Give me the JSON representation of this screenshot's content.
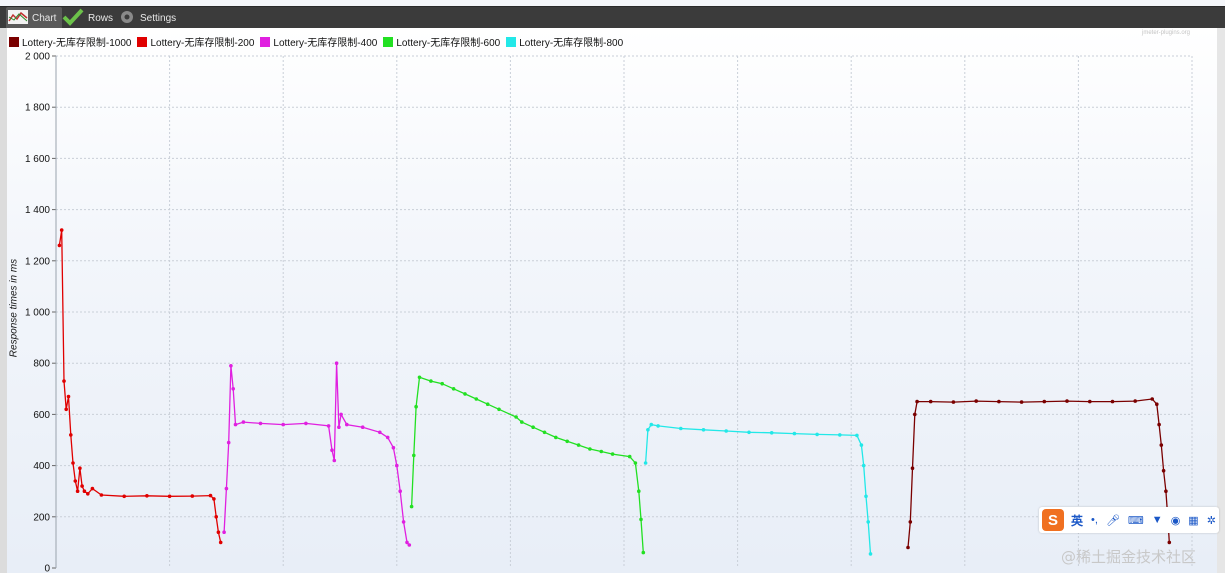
{
  "toolbar": {
    "tabs": [
      {
        "label": "Chart",
        "icon": "chart-icon"
      },
      {
        "label": "Rows",
        "icon": "checkmark-icon"
      },
      {
        "label": "Settings",
        "icon": "gear-icon"
      }
    ]
  },
  "watermark_top": "jmeter-plugins.org",
  "footer_watermark": "@稀土掘金技术社区",
  "ime_toolbar": {
    "logo": "S",
    "label": "英",
    "icons": [
      "punctuation-icon",
      "microphone-icon",
      "keyboard-icon",
      "shirt-icon",
      "gamepad-icon",
      "grid-icon",
      "gear-icon"
    ]
  },
  "chart_data": {
    "type": "line",
    "ylabel": "Response times in ms",
    "ylim": [
      0,
      2000
    ],
    "yticks": [
      0,
      200,
      400,
      600,
      800,
      1000,
      1200,
      1400,
      1600,
      1800,
      2000
    ],
    "ytick_labels": [
      "0",
      "200",
      "400",
      "600",
      "800",
      "1 000",
      "1 200",
      "1 400",
      "1 600",
      "1 800",
      "2 000"
    ],
    "x_range": [
      0,
      100
    ],
    "grid": true,
    "legend_position": "top-left",
    "series": [
      {
        "name": "Lottery-无库存限制-1000",
        "color": "#7a0000",
        "points": [
          [
            75.0,
            80
          ],
          [
            75.2,
            180
          ],
          [
            75.4,
            390
          ],
          [
            75.6,
            600
          ],
          [
            75.8,
            650
          ],
          [
            77,
            650
          ],
          [
            79,
            648
          ],
          [
            81,
            652
          ],
          [
            83,
            650
          ],
          [
            85,
            648
          ],
          [
            87,
            650
          ],
          [
            89,
            652
          ],
          [
            91,
            650
          ],
          [
            93,
            650
          ],
          [
            95,
            652
          ],
          [
            96.5,
            660
          ],
          [
            96.9,
            640
          ],
          [
            97.1,
            560
          ],
          [
            97.3,
            480
          ],
          [
            97.5,
            380
          ],
          [
            97.7,
            300
          ],
          [
            97.9,
            180
          ],
          [
            98.0,
            100
          ]
        ]
      },
      {
        "name": "Lottery-无库存限制-200",
        "color": "#e00000",
        "points": [
          [
            0.3,
            1260
          ],
          [
            0.5,
            1320
          ],
          [
            0.7,
            730
          ],
          [
            0.9,
            620
          ],
          [
            1.1,
            670
          ],
          [
            1.3,
            520
          ],
          [
            1.5,
            410
          ],
          [
            1.7,
            340
          ],
          [
            1.9,
            300
          ],
          [
            2.1,
            390
          ],
          [
            2.3,
            320
          ],
          [
            2.5,
            300
          ],
          [
            2.8,
            290
          ],
          [
            3.2,
            310
          ],
          [
            4,
            285
          ],
          [
            6,
            280
          ],
          [
            8,
            282
          ],
          [
            10,
            280
          ],
          [
            12,
            281
          ],
          [
            13.6,
            283
          ],
          [
            13.9,
            270
          ],
          [
            14.1,
            200
          ],
          [
            14.3,
            140
          ],
          [
            14.5,
            100
          ]
        ]
      },
      {
        "name": "Lottery-无库存限制-400",
        "color": "#e020e0",
        "points": [
          [
            14.8,
            140
          ],
          [
            15.0,
            310
          ],
          [
            15.2,
            490
          ],
          [
            15.4,
            790
          ],
          [
            15.6,
            700
          ],
          [
            15.8,
            560
          ],
          [
            16.5,
            570
          ],
          [
            18,
            565
          ],
          [
            20,
            560
          ],
          [
            22,
            565
          ],
          [
            24,
            555
          ],
          [
            24.3,
            460
          ],
          [
            24.5,
            420
          ],
          [
            24.7,
            800
          ],
          [
            24.9,
            550
          ],
          [
            25.1,
            600
          ],
          [
            25.6,
            560
          ],
          [
            27,
            550
          ],
          [
            28.5,
            530
          ],
          [
            29.2,
            510
          ],
          [
            29.7,
            470
          ],
          [
            30.0,
            400
          ],
          [
            30.3,
            300
          ],
          [
            30.6,
            180
          ],
          [
            30.9,
            100
          ],
          [
            31.1,
            90
          ]
        ]
      },
      {
        "name": "Lottery-无库存限制-600",
        "color": "#22e022",
        "points": [
          [
            31.3,
            240
          ],
          [
            31.5,
            440
          ],
          [
            31.7,
            630
          ],
          [
            32.0,
            745
          ],
          [
            33,
            730
          ],
          [
            34,
            720
          ],
          [
            35,
            700
          ],
          [
            36,
            680
          ],
          [
            37,
            660
          ],
          [
            38,
            640
          ],
          [
            39,
            620
          ],
          [
            40.5,
            590
          ],
          [
            41,
            570
          ],
          [
            42,
            550
          ],
          [
            43,
            530
          ],
          [
            44,
            510
          ],
          [
            45,
            495
          ],
          [
            46,
            480
          ],
          [
            47,
            465
          ],
          [
            48,
            455
          ],
          [
            49,
            445
          ],
          [
            50.5,
            435
          ],
          [
            51.0,
            410
          ],
          [
            51.3,
            300
          ],
          [
            51.5,
            190
          ],
          [
            51.7,
            60
          ]
        ]
      },
      {
        "name": "Lottery-无库存限制-800",
        "color": "#22e8e8",
        "points": [
          [
            51.9,
            410
          ],
          [
            52.1,
            540
          ],
          [
            52.4,
            560
          ],
          [
            53,
            555
          ],
          [
            55,
            545
          ],
          [
            57,
            540
          ],
          [
            59,
            535
          ],
          [
            61,
            530
          ],
          [
            63,
            528
          ],
          [
            65,
            525
          ],
          [
            67,
            522
          ],
          [
            69,
            520
          ],
          [
            70.5,
            518
          ],
          [
            70.9,
            480
          ],
          [
            71.1,
            400
          ],
          [
            71.3,
            280
          ],
          [
            71.5,
            180
          ],
          [
            71.7,
            55
          ]
        ]
      }
    ]
  }
}
